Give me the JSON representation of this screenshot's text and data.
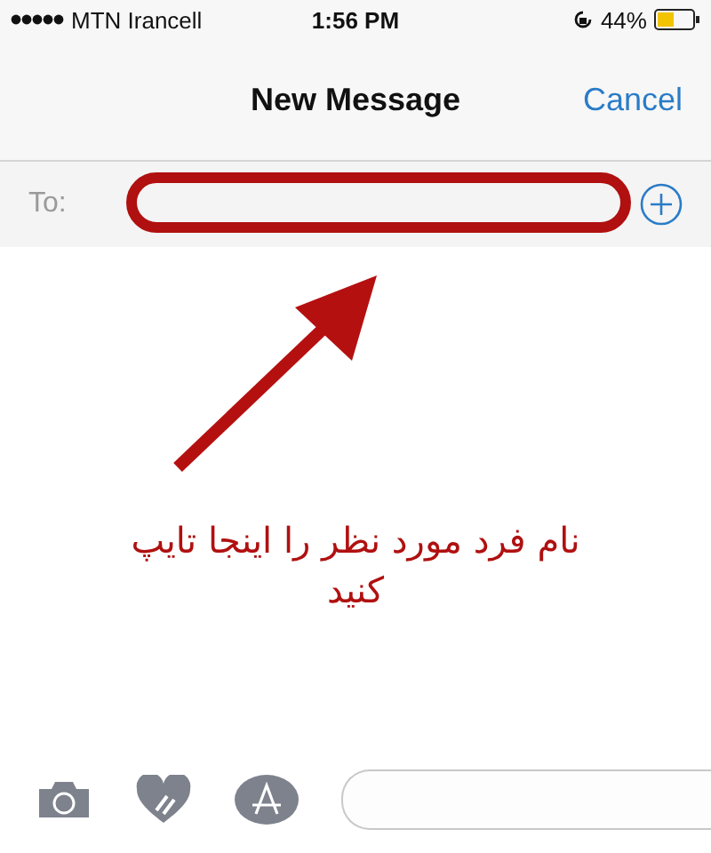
{
  "status_bar": {
    "carrier": "MTN Irancell",
    "time": "1:56 PM",
    "battery": "44%"
  },
  "nav": {
    "title": "New Message",
    "cancel": "Cancel"
  },
  "to_field": {
    "label": "To:"
  },
  "annotation": {
    "text": "نام فرد مورد نظر را اینجا تایپ کنید"
  }
}
